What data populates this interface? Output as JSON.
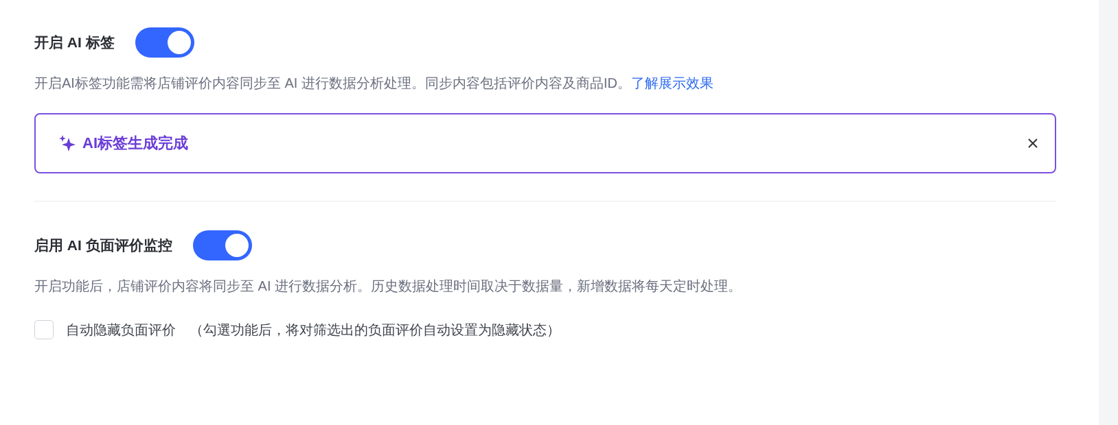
{
  "sections": [
    {
      "title": "开启 AI 标签",
      "enabled": true,
      "description": "开启AI标签功能需将店铺评价内容同步至 AI 进行数据分析处理。同步内容包括评价内容及商品ID。",
      "link": "了解展示效果",
      "alert": {
        "text": "AI标签生成完成"
      }
    },
    {
      "title": "启用 AI 负面评价监控",
      "enabled": true,
      "description": "开启功能后，店铺评价内容将同步至 AI 进行数据分析。历史数据处理时间取决于数据量，新增数据将每天定时处理。",
      "options": [
        {
          "label": "自动隐藏负面评价",
          "note": "（勾選功能后，将对筛选出的负面评价自动设置为隐藏状态）",
          "checked": false
        }
      ]
    }
  ]
}
